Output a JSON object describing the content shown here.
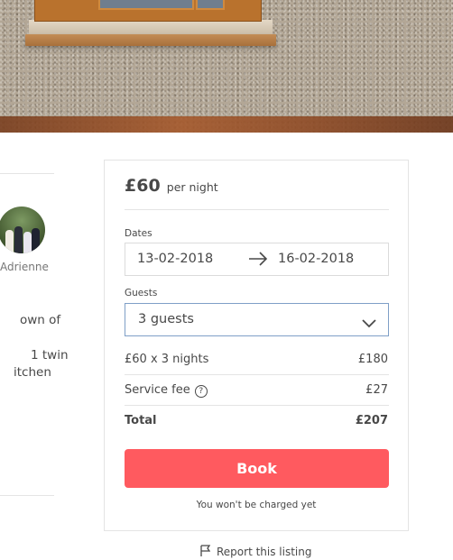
{
  "listing": {
    "host_name": "Adrienne",
    "description_fragments": [
      "own of",
      "1 twin",
      "itchen"
    ]
  },
  "booking": {
    "price": "£60",
    "per_night": "per night",
    "dates_label": "Dates",
    "check_in": "13-02-2018",
    "check_out": "16-02-2018",
    "guests_label": "Guests",
    "guests_value": "3 guests",
    "nights_label": "£60 x 3 nights",
    "nights_value": "£180",
    "service_fee_label": "Service fee",
    "service_fee_help": "?",
    "service_fee_value": "£27",
    "total_label": "Total",
    "total_value": "£207",
    "book_label": "Book",
    "note": "You won't be charged yet"
  },
  "footer": {
    "report_label": "Report this listing"
  },
  "colors": {
    "brand": "#ff5a5f",
    "focus_border": "#7f9fc7",
    "text": "#484848",
    "divider": "#e4e4e4"
  },
  "icons": {
    "arrow": "arrow-right-icon",
    "chevron": "chevron-down-icon",
    "help": "question-circle-icon",
    "flag": "flag-icon"
  }
}
